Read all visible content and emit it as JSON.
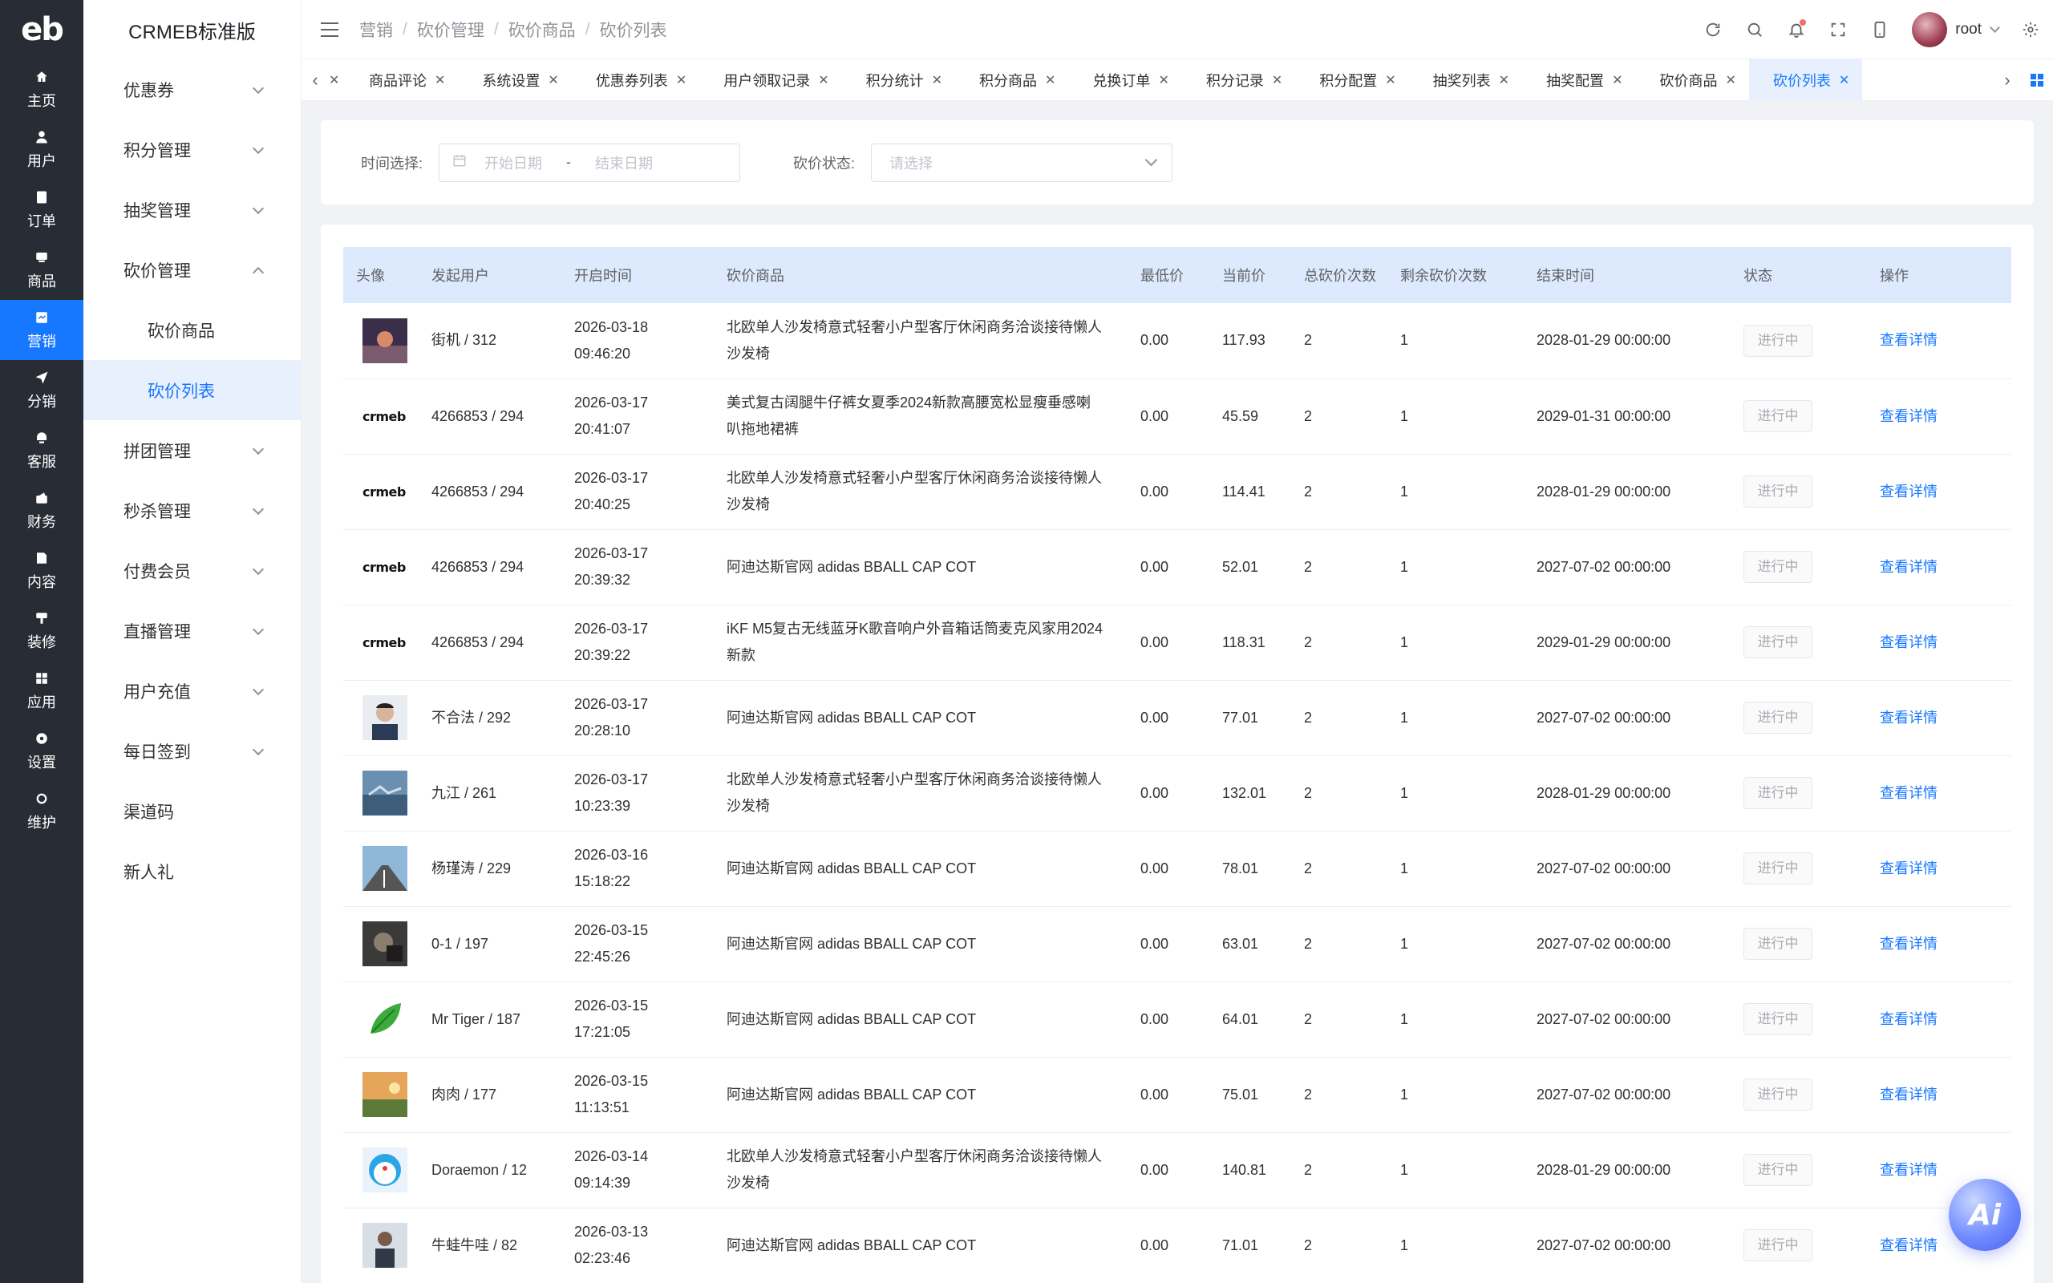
{
  "rail": {
    "logo": "eb",
    "items": [
      {
        "label": "主页",
        "icon": "home-icon"
      },
      {
        "label": "用户",
        "icon": "user-icon"
      },
      {
        "label": "订单",
        "icon": "order-icon"
      },
      {
        "label": "商品",
        "icon": "goods-icon"
      },
      {
        "label": "营销",
        "icon": "marketing-icon"
      },
      {
        "label": "分销",
        "icon": "distribution-icon"
      },
      {
        "label": "客服",
        "icon": "service-icon"
      },
      {
        "label": "财务",
        "icon": "finance-icon"
      },
      {
        "label": "内容",
        "icon": "content-icon"
      },
      {
        "label": "装修",
        "icon": "decoration-icon"
      },
      {
        "label": "应用",
        "icon": "apps-icon"
      },
      {
        "label": "设置",
        "icon": "settings-icon"
      },
      {
        "label": "维护",
        "icon": "maintenance-icon"
      }
    ],
    "active_index": 4
  },
  "menu": {
    "title": "CRMEB标准版",
    "items": [
      {
        "label": "优惠券"
      },
      {
        "label": "积分管理"
      },
      {
        "label": "抽奖管理"
      },
      {
        "label": "砍价管理"
      },
      {
        "label": "砍价商品"
      },
      {
        "label": "砍价列表"
      },
      {
        "label": "拼团管理"
      },
      {
        "label": "秒杀管理"
      },
      {
        "label": "付费会员"
      },
      {
        "label": "直播管理"
      },
      {
        "label": "用户充值"
      },
      {
        "label": "每日签到"
      },
      {
        "label": "渠道码"
      },
      {
        "label": "新人礼"
      }
    ]
  },
  "header": {
    "breadcrumbs": [
      "营销",
      "砍价管理",
      "砍价商品",
      "砍价列表"
    ],
    "user": "root"
  },
  "tabs": [
    {
      "label": "商品评论"
    },
    {
      "label": "系统设置"
    },
    {
      "label": "优惠券列表"
    },
    {
      "label": "用户领取记录"
    },
    {
      "label": "积分统计"
    },
    {
      "label": "积分商品"
    },
    {
      "label": "兑换订单"
    },
    {
      "label": "积分记录"
    },
    {
      "label": "积分配置"
    },
    {
      "label": "抽奖列表"
    },
    {
      "label": "抽奖配置"
    },
    {
      "label": "砍价商品"
    },
    {
      "label": "砍价列表"
    }
  ],
  "filters": {
    "time_label": "时间选择:",
    "start_placeholder": "开始日期",
    "range_sep": "-",
    "end_placeholder": "结束日期",
    "status_label": "砍价状态:",
    "status_placeholder": "请选择"
  },
  "table": {
    "columns": [
      "头像",
      "发起用户",
      "开启时间",
      "砍价商品",
      "最低价",
      "当前价",
      "总砍价次数",
      "剩余砍价次数",
      "结束时间",
      "状态",
      "操作"
    ],
    "rows": [
      {
        "avatar": "photo",
        "user": "街机 / 312",
        "start": "2026-03-18 09:46:20",
        "product": "北欧单人沙发椅意式轻奢小户型客厅休闲商务洽谈接待懒人沙发椅",
        "min": "0.00",
        "cur": "117.93",
        "total": "2",
        "left": "1",
        "end": "2028-01-29 00:00:00",
        "status": "进行中",
        "action": "查看详情"
      },
      {
        "avatar": "crmeb",
        "user": "4266853 / 294",
        "start": "2026-03-17 20:41:07",
        "product": "美式复古阔腿牛仔裤女夏季2024新款高腰宽松显瘦垂感喇叭拖地裙裤",
        "min": "0.00",
        "cur": "45.59",
        "total": "2",
        "left": "1",
        "end": "2029-01-31 00:00:00",
        "status": "进行中",
        "action": "查看详情"
      },
      {
        "avatar": "crmeb",
        "user": "4266853 / 294",
        "start": "2026-03-17 20:40:25",
        "product": "北欧单人沙发椅意式轻奢小户型客厅休闲商务洽谈接待懒人沙发椅",
        "min": "0.00",
        "cur": "114.41",
        "total": "2",
        "left": "1",
        "end": "2028-01-29 00:00:00",
        "status": "进行中",
        "action": "查看详情"
      },
      {
        "avatar": "crmeb",
        "user": "4266853 / 294",
        "start": "2026-03-17 20:39:32",
        "product": "阿迪达斯官网 adidas BBALL CAP COT",
        "min": "0.00",
        "cur": "52.01",
        "total": "2",
        "left": "1",
        "end": "2027-07-02 00:00:00",
        "status": "进行中",
        "action": "查看详情"
      },
      {
        "avatar": "crmeb",
        "user": "4266853 / 294",
        "start": "2026-03-17 20:39:22",
        "product": "iKF M5复古无线蓝牙K歌音响户外音箱话筒麦克风家用2024新款",
        "min": "0.00",
        "cur": "118.31",
        "total": "2",
        "left": "1",
        "end": "2029-01-29 00:00:00",
        "status": "进行中",
        "action": "查看详情"
      },
      {
        "avatar": "face",
        "user": "不合法 / 292",
        "start": "2026-03-17 20:28:10",
        "product": "阿迪达斯官网 adidas BBALL CAP COT",
        "min": "0.00",
        "cur": "77.01",
        "total": "2",
        "left": "1",
        "end": "2027-07-02 00:00:00",
        "status": "进行中",
        "action": "查看详情"
      },
      {
        "avatar": "sky",
        "user": "九江 / 261",
        "start": "2026-03-17 10:23:39",
        "product": "北欧单人沙发椅意式轻奢小户型客厅休闲商务洽谈接待懒人沙发椅",
        "min": "0.00",
        "cur": "132.01",
        "total": "2",
        "left": "1",
        "end": "2028-01-29 00:00:00",
        "status": "进行中",
        "action": "查看详情"
      },
      {
        "avatar": "road",
        "user": "杨瑾涛 / 229",
        "start": "2026-03-16 15:18:22",
        "product": "阿迪达斯官网 adidas BBALL CAP COT",
        "min": "0.00",
        "cur": "78.01",
        "total": "2",
        "left": "1",
        "end": "2027-07-02 00:00:00",
        "status": "进行中",
        "action": "查看详情"
      },
      {
        "avatar": "dark",
        "user": "0-1 / 197",
        "start": "2026-03-15 22:45:26",
        "product": "阿迪达斯官网 adidas BBALL CAP COT",
        "min": "0.00",
        "cur": "63.01",
        "total": "2",
        "left": "1",
        "end": "2027-07-02 00:00:00",
        "status": "进行中",
        "action": "查看详情"
      },
      {
        "avatar": "leaf",
        "user": "Mr Tiger / 187",
        "start": "2026-03-15 17:21:05",
        "product": "阿迪达斯官网 adidas BBALL CAP COT",
        "min": "0.00",
        "cur": "64.01",
        "total": "2",
        "left": "1",
        "end": "2027-07-02 00:00:00",
        "status": "进行中",
        "action": "查看详情"
      },
      {
        "avatar": "sunset",
        "user": "肉肉 / 177",
        "start": "2026-03-15 11:13:51",
        "product": "阿迪达斯官网 adidas BBALL CAP COT",
        "min": "0.00",
        "cur": "75.01",
        "total": "2",
        "left": "1",
        "end": "2027-07-02 00:00:00",
        "status": "进行中",
        "action": "查看详情"
      },
      {
        "avatar": "cartoon",
        "user": "Doraemon / 12",
        "start": "2026-03-14 09:14:39",
        "product": "北欧单人沙发椅意式轻奢小户型客厅休闲商务洽谈接待懒人沙发椅",
        "min": "0.00",
        "cur": "140.81",
        "total": "2",
        "left": "1",
        "end": "2028-01-29 00:00:00",
        "status": "进行中",
        "action": "查看详情"
      },
      {
        "avatar": "person",
        "user": "牛蛙牛哇 / 82",
        "start": "2026-03-13 02:23:46",
        "product": "阿迪达斯官网 adidas BBALL CAP COT",
        "min": "0.00",
        "cur": "71.01",
        "total": "2",
        "left": "1",
        "end": "2027-07-02 00:00:00",
        "status": "进行中",
        "action": "查看详情"
      }
    ]
  },
  "ai_button": "Ai",
  "colors": {
    "primary": "#1677ff",
    "rail_bg": "#282c34",
    "header_row": "#dde9fd"
  }
}
